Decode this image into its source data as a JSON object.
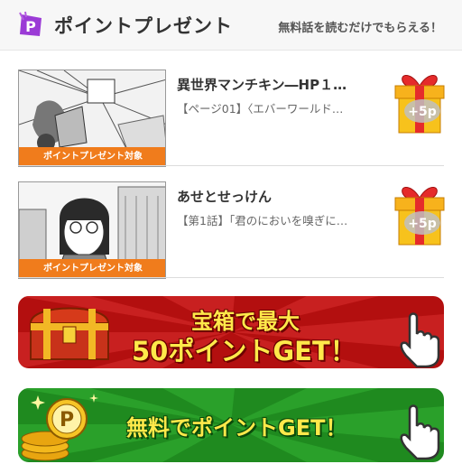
{
  "header": {
    "icon": "point-p-icon",
    "title": "ポイントプレゼント",
    "subtitle": "無料話を読むだけでもらえる！"
  },
  "items": [
    {
      "title": "異世界マンチキン―HP１…",
      "desc": "【ページ01】〈エバーワールド…",
      "tag": "ポイントプレゼント対象",
      "points": "+5p"
    },
    {
      "title": "あせとせっけん",
      "desc": "【第1話】「君のにおいを嗅ぎに…",
      "tag": "ポイントプレゼント対象",
      "points": "+5p"
    }
  ],
  "banners": {
    "treasure": {
      "line1": "宝箱で最大",
      "line2": "50ポイントGET！",
      "icon": "treasure-chest-icon"
    },
    "free": {
      "text": "無料でポイントGET！",
      "icon": "coin-stack-icon"
    }
  },
  "colors": {
    "tag": "#f07c1c",
    "treasure_bg": "#b30f0f",
    "free_bg": "#1f8a1f",
    "accent_yellow": "#ffe94a"
  }
}
